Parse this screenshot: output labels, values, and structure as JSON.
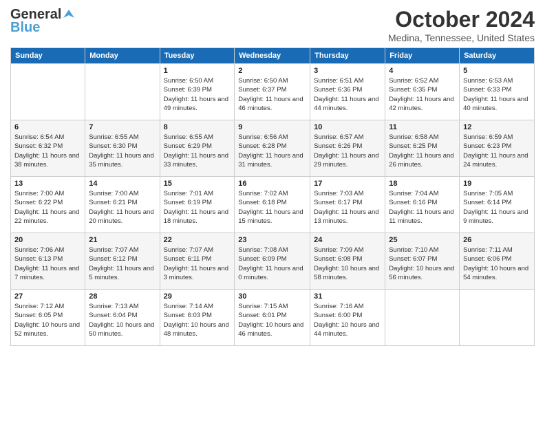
{
  "header": {
    "logo_general": "General",
    "logo_blue": "Blue",
    "month_title": "October 2024",
    "location": "Medina, Tennessee, United States"
  },
  "days_of_week": [
    "Sunday",
    "Monday",
    "Tuesday",
    "Wednesday",
    "Thursday",
    "Friday",
    "Saturday"
  ],
  "weeks": [
    [
      {
        "day": "",
        "sunrise": "",
        "sunset": "",
        "daylight": ""
      },
      {
        "day": "",
        "sunrise": "",
        "sunset": "",
        "daylight": ""
      },
      {
        "day": "1",
        "sunrise": "Sunrise: 6:50 AM",
        "sunset": "Sunset: 6:39 PM",
        "daylight": "Daylight: 11 hours and 49 minutes."
      },
      {
        "day": "2",
        "sunrise": "Sunrise: 6:50 AM",
        "sunset": "Sunset: 6:37 PM",
        "daylight": "Daylight: 11 hours and 46 minutes."
      },
      {
        "day": "3",
        "sunrise": "Sunrise: 6:51 AM",
        "sunset": "Sunset: 6:36 PM",
        "daylight": "Daylight: 11 hours and 44 minutes."
      },
      {
        "day": "4",
        "sunrise": "Sunrise: 6:52 AM",
        "sunset": "Sunset: 6:35 PM",
        "daylight": "Daylight: 11 hours and 42 minutes."
      },
      {
        "day": "5",
        "sunrise": "Sunrise: 6:53 AM",
        "sunset": "Sunset: 6:33 PM",
        "daylight": "Daylight: 11 hours and 40 minutes."
      }
    ],
    [
      {
        "day": "6",
        "sunrise": "Sunrise: 6:54 AM",
        "sunset": "Sunset: 6:32 PM",
        "daylight": "Daylight: 11 hours and 38 minutes."
      },
      {
        "day": "7",
        "sunrise": "Sunrise: 6:55 AM",
        "sunset": "Sunset: 6:30 PM",
        "daylight": "Daylight: 11 hours and 35 minutes."
      },
      {
        "day": "8",
        "sunrise": "Sunrise: 6:55 AM",
        "sunset": "Sunset: 6:29 PM",
        "daylight": "Daylight: 11 hours and 33 minutes."
      },
      {
        "day": "9",
        "sunrise": "Sunrise: 6:56 AM",
        "sunset": "Sunset: 6:28 PM",
        "daylight": "Daylight: 11 hours and 31 minutes."
      },
      {
        "day": "10",
        "sunrise": "Sunrise: 6:57 AM",
        "sunset": "Sunset: 6:26 PM",
        "daylight": "Daylight: 11 hours and 29 minutes."
      },
      {
        "day": "11",
        "sunrise": "Sunrise: 6:58 AM",
        "sunset": "Sunset: 6:25 PM",
        "daylight": "Daylight: 11 hours and 26 minutes."
      },
      {
        "day": "12",
        "sunrise": "Sunrise: 6:59 AM",
        "sunset": "Sunset: 6:23 PM",
        "daylight": "Daylight: 11 hours and 24 minutes."
      }
    ],
    [
      {
        "day": "13",
        "sunrise": "Sunrise: 7:00 AM",
        "sunset": "Sunset: 6:22 PM",
        "daylight": "Daylight: 11 hours and 22 minutes."
      },
      {
        "day": "14",
        "sunrise": "Sunrise: 7:00 AM",
        "sunset": "Sunset: 6:21 PM",
        "daylight": "Daylight: 11 hours and 20 minutes."
      },
      {
        "day": "15",
        "sunrise": "Sunrise: 7:01 AM",
        "sunset": "Sunset: 6:19 PM",
        "daylight": "Daylight: 11 hours and 18 minutes."
      },
      {
        "day": "16",
        "sunrise": "Sunrise: 7:02 AM",
        "sunset": "Sunset: 6:18 PM",
        "daylight": "Daylight: 11 hours and 15 minutes."
      },
      {
        "day": "17",
        "sunrise": "Sunrise: 7:03 AM",
        "sunset": "Sunset: 6:17 PM",
        "daylight": "Daylight: 11 hours and 13 minutes."
      },
      {
        "day": "18",
        "sunrise": "Sunrise: 7:04 AM",
        "sunset": "Sunset: 6:16 PM",
        "daylight": "Daylight: 11 hours and 11 minutes."
      },
      {
        "day": "19",
        "sunrise": "Sunrise: 7:05 AM",
        "sunset": "Sunset: 6:14 PM",
        "daylight": "Daylight: 11 hours and 9 minutes."
      }
    ],
    [
      {
        "day": "20",
        "sunrise": "Sunrise: 7:06 AM",
        "sunset": "Sunset: 6:13 PM",
        "daylight": "Daylight: 11 hours and 7 minutes."
      },
      {
        "day": "21",
        "sunrise": "Sunrise: 7:07 AM",
        "sunset": "Sunset: 6:12 PM",
        "daylight": "Daylight: 11 hours and 5 minutes."
      },
      {
        "day": "22",
        "sunrise": "Sunrise: 7:07 AM",
        "sunset": "Sunset: 6:11 PM",
        "daylight": "Daylight: 11 hours and 3 minutes."
      },
      {
        "day": "23",
        "sunrise": "Sunrise: 7:08 AM",
        "sunset": "Sunset: 6:09 PM",
        "daylight": "Daylight: 11 hours and 0 minutes."
      },
      {
        "day": "24",
        "sunrise": "Sunrise: 7:09 AM",
        "sunset": "Sunset: 6:08 PM",
        "daylight": "Daylight: 10 hours and 58 minutes."
      },
      {
        "day": "25",
        "sunrise": "Sunrise: 7:10 AM",
        "sunset": "Sunset: 6:07 PM",
        "daylight": "Daylight: 10 hours and 56 minutes."
      },
      {
        "day": "26",
        "sunrise": "Sunrise: 7:11 AM",
        "sunset": "Sunset: 6:06 PM",
        "daylight": "Daylight: 10 hours and 54 minutes."
      }
    ],
    [
      {
        "day": "27",
        "sunrise": "Sunrise: 7:12 AM",
        "sunset": "Sunset: 6:05 PM",
        "daylight": "Daylight: 10 hours and 52 minutes."
      },
      {
        "day": "28",
        "sunrise": "Sunrise: 7:13 AM",
        "sunset": "Sunset: 6:04 PM",
        "daylight": "Daylight: 10 hours and 50 minutes."
      },
      {
        "day": "29",
        "sunrise": "Sunrise: 7:14 AM",
        "sunset": "Sunset: 6:03 PM",
        "daylight": "Daylight: 10 hours and 48 minutes."
      },
      {
        "day": "30",
        "sunrise": "Sunrise: 7:15 AM",
        "sunset": "Sunset: 6:01 PM",
        "daylight": "Daylight: 10 hours and 46 minutes."
      },
      {
        "day": "31",
        "sunrise": "Sunrise: 7:16 AM",
        "sunset": "Sunset: 6:00 PM",
        "daylight": "Daylight: 10 hours and 44 minutes."
      },
      {
        "day": "",
        "sunrise": "",
        "sunset": "",
        "daylight": ""
      },
      {
        "day": "",
        "sunrise": "",
        "sunset": "",
        "daylight": ""
      }
    ]
  ]
}
